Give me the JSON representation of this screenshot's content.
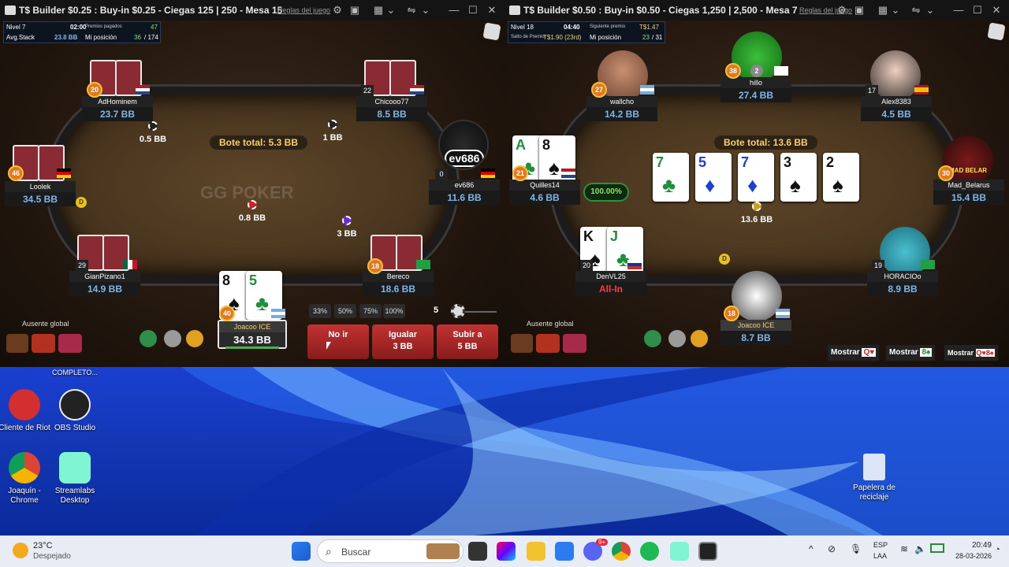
{
  "left_window": {
    "title": "T$ Builder $0.25 : Buy-in $0.25 - Ciegas 125 | 250 - Mesa 15",
    "rules_link": "Reglas del juego",
    "info": {
      "level_label": "Nivel 7",
      "level_time": "02:00",
      "paid_label": "Premios pagados",
      "paid_value": "47",
      "avg_label": "Avg.Stack",
      "avg_value": "23.8 BB",
      "pos_label": "Mi posición",
      "pos_value": "36",
      "pos_total": "/ 174"
    },
    "watermark": "GG POKER",
    "pot": "Bote total: 5.3 BB",
    "seats": [
      {
        "name": "AdHominem",
        "stack": "23.7 BB",
        "level": "20"
      },
      {
        "name": "Chicooo77",
        "stack": "8.5 BB",
        "level": "22"
      },
      {
        "name": "Loolek",
        "stack": "34.5 BB",
        "level": "46"
      },
      {
        "name": "ev686",
        "stack": "11.6 BB",
        "level": "0",
        "avatar_text": "ev686"
      },
      {
        "name": "GianPizano1",
        "stack": "14.9 BB",
        "level": "29"
      },
      {
        "name": "Bereco",
        "stack": "18.6 BB",
        "level": "18"
      },
      {
        "name": "Joacoo ICE",
        "stack": "34.3 BB",
        "level": "40"
      }
    ],
    "bets": [
      "0.5 BB",
      "1 BB",
      "0.8 BB",
      "3 BB"
    ],
    "hero_cards": [
      {
        "rank": "8",
        "suit": "♠"
      },
      {
        "rank": "5",
        "suit": "♣"
      }
    ],
    "dealer": "D",
    "away": "Ausente global",
    "bet_pcts": [
      "33%",
      "50%",
      "75%",
      "100%"
    ],
    "bet_amount": "5",
    "actions": [
      {
        "label": "No ir",
        "sub": ""
      },
      {
        "label": "Igualar",
        "sub": "3 BB"
      },
      {
        "label": "Subir a",
        "sub": "5 BB"
      }
    ]
  },
  "right_window": {
    "title": "T$ Builder $0.50 : Buy-in $0.50 - Ciegas 1,250 | 2,500 - Mesa 7",
    "rules_link": "Reglas del juego",
    "info": {
      "level_label": "Nivel 18",
      "level_time": "04:40",
      "next_label": "Siguiente premio",
      "next_value": "T$1.47",
      "jump_label": "Salto de Premio",
      "jump_value": "T$1.90 (23rd)",
      "pos_label": "Mi posición",
      "pos_value": "23",
      "pos_total": "/ 31"
    },
    "pot": "Bote total: 13.6 BB",
    "center_bet": "13.6 BB",
    "board": [
      {
        "rank": "7",
        "suit": "♣",
        "color": "green"
      },
      {
        "rank": "5",
        "suit": "♦",
        "color": "red"
      },
      {
        "rank": "7",
        "suit": "♦",
        "color": "red"
      },
      {
        "rank": "3",
        "suit": "♠",
        "color": "black"
      },
      {
        "rank": "2",
        "suit": "♠",
        "color": "black"
      }
    ],
    "seats": [
      {
        "name": "wallcho",
        "stack": "14.2 BB",
        "level": "27"
      },
      {
        "name": "hillo",
        "stack": "27.4 BB",
        "level": "38",
        "badge": "2"
      },
      {
        "name": "Alex8383",
        "stack": "4.5 BB",
        "level": "17"
      },
      {
        "name": "Quilles14",
        "stack": "4.6 BB",
        "level": "21"
      },
      {
        "name": "Mad_Belarus",
        "stack": "15.4 BB",
        "level": "30",
        "avatar_text": "MAD BELAR"
      },
      {
        "name": "DenVL25",
        "stack": "All-In",
        "level": "20"
      },
      {
        "name": "HORACIOo",
        "stack": "8.9 BB",
        "level": "19"
      },
      {
        "name": "Joacoo ICE",
        "stack": "8.7 BB",
        "level": "18"
      }
    ],
    "quilles_cards": [
      {
        "rank": "A",
        "suit": "♣"
      },
      {
        "rank": "8",
        "suit": "♠"
      }
    ],
    "denvl_cards": [
      {
        "rank": "K",
        "suit": "♠"
      },
      {
        "rank": "J",
        "suit": "♣"
      }
    ],
    "equity": "100.00%",
    "dealer": "D",
    "away": "Ausente global",
    "show_buttons": [
      "Mostrar",
      "Mostrar",
      "Mostrar"
    ],
    "show_cards": [
      "Q♥",
      "8♠",
      "Q♥8♠"
    ]
  },
  "desktop": {
    "completo_label": "COMPLETO...",
    "icons": [
      {
        "label": "Cliente de Riot"
      },
      {
        "label": "OBS Studio"
      },
      {
        "label": "Joaquín - Chrome"
      },
      {
        "label": "Streamlabs Desktop"
      },
      {
        "label": "Papelera de reciclaje"
      }
    ]
  },
  "taskbar": {
    "weather_temp": "23°C",
    "weather_desc": "Despejado",
    "search_placeholder": "Buscar",
    "lang1": "ESP",
    "lang2": "LAA",
    "time": "20:49",
    "date": "28-03-2026",
    "chat_badge": "9+"
  },
  "colors": {
    "stack_blue": "#7fb6e6",
    "pot_gold": "#f6d06a",
    "action_red": "#c23232",
    "allin_red": "#ff3b3b",
    "taskbar": "#e8edf5"
  }
}
